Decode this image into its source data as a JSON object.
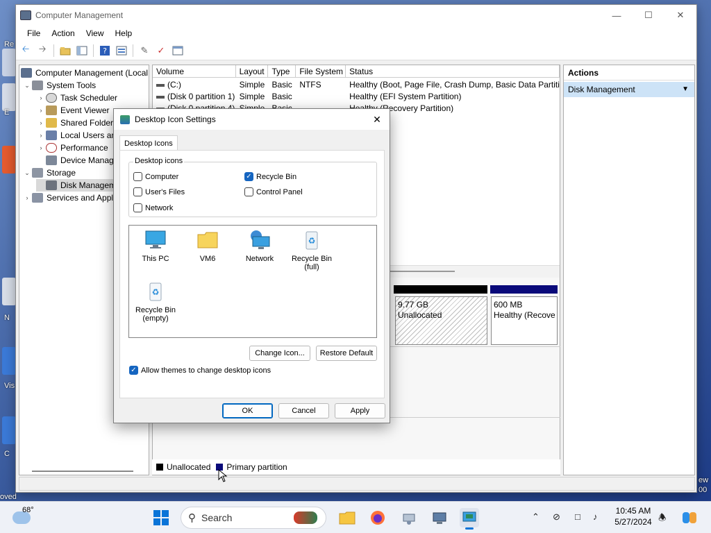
{
  "desktop": {
    "labels": [
      "Re",
      "E",
      "N",
      "Vis",
      "C"
    ],
    "right_labels": [
      "ew",
      "00"
    ],
    "bottom_left_label": "oved"
  },
  "window": {
    "title": "Computer Management",
    "menu": [
      "File",
      "Action",
      "View",
      "Help"
    ],
    "tree": [
      {
        "label": "Computer Management (Local",
        "indent": 0,
        "expander": ""
      },
      {
        "label": "System Tools",
        "indent": 1,
        "expander": "˅"
      },
      {
        "label": "Task Scheduler",
        "indent": 2,
        "expander": "›"
      },
      {
        "label": "Event Viewer",
        "indent": 2,
        "expander": "›"
      },
      {
        "label": "Shared Folders",
        "indent": 2,
        "expander": "›"
      },
      {
        "label": "Local Users an",
        "indent": 2,
        "expander": "›"
      },
      {
        "label": "Performance",
        "indent": 2,
        "expander": "›"
      },
      {
        "label": "Device Manag",
        "indent": 2,
        "expander": ""
      },
      {
        "label": "Storage",
        "indent": 1,
        "expander": "˅"
      },
      {
        "label": "Disk Managem",
        "indent": 2,
        "expander": ""
      },
      {
        "label": "Services and Appl",
        "indent": 1,
        "expander": "›"
      }
    ],
    "volume_columns": [
      "Volume",
      "Layout",
      "Type",
      "File System",
      "Status"
    ],
    "volumes": [
      {
        "volume": "(C:)",
        "layout": "Simple",
        "type": "Basic",
        "fs": "NTFS",
        "status": "Healthy (Boot, Page File, Crash Dump, Basic Data Partition"
      },
      {
        "volume": "(Disk 0 partition 1)",
        "layout": "Simple",
        "type": "Basic",
        "fs": "",
        "status": "Healthy (EFI System Partition)"
      },
      {
        "volume": "(Disk 0 partition 4)",
        "layout": "Simple",
        "type": "Basic",
        "fs": "",
        "status": "Healthy (Recovery Partition)"
      }
    ],
    "disk_boxes": [
      {
        "line1": "9.77 GB",
        "line2": "Unallocated"
      },
      {
        "line1": "600 MB",
        "line2": "Healthy (Recove"
      }
    ],
    "legend": {
      "unallocated": "Unallocated",
      "primary": "Primary partition"
    },
    "actions": {
      "header": "Actions",
      "selected": "Disk Management"
    }
  },
  "dialog": {
    "title": "Desktop Icon Settings",
    "tab": "Desktop Icons",
    "group_label": "Desktop icons",
    "checkboxes": {
      "computer": {
        "label": "Computer",
        "checked": false
      },
      "users_files": {
        "label": "User's Files",
        "checked": false
      },
      "network": {
        "label": "Network",
        "checked": false
      },
      "recycle_bin": {
        "label": "Recycle Bin",
        "checked": true
      },
      "control_panel": {
        "label": "Control Panel",
        "checked": false
      }
    },
    "icons": {
      "this_pc": "This PC",
      "vm6": "VM6",
      "network": "Network",
      "recycle_full_1": "Recycle Bin",
      "recycle_full_2": "(full)",
      "recycle_empty_1": "Recycle Bin",
      "recycle_empty_2": "(empty)"
    },
    "change_icon": "Change Icon...",
    "restore_default": "Restore Default",
    "allow_themes": {
      "label": "Allow themes to change desktop icons",
      "checked": true
    },
    "ok": "OK",
    "cancel": "Cancel",
    "apply": "Apply"
  },
  "taskbar": {
    "weather_temp": "68°",
    "search_placeholder": "Search",
    "time": "10:45 AM",
    "date": "5/27/2024"
  },
  "colors": {
    "accent": "#1565c0",
    "primary_partition": "#0a0a7a",
    "unallocated": "#000000",
    "selection": "#cde3f7"
  }
}
